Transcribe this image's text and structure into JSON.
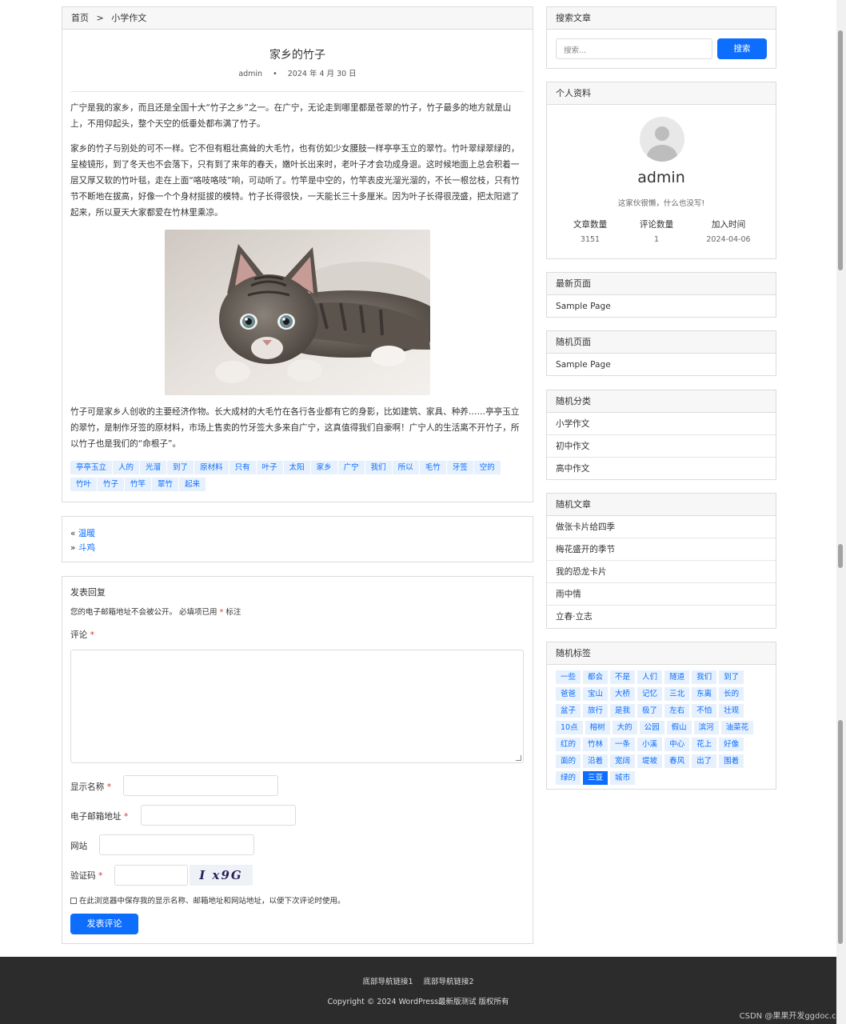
{
  "breadcrumb": {
    "home": "首页",
    "sep": ">",
    "current": "小学作文"
  },
  "post": {
    "title": "家乡的竹子",
    "author": "admin",
    "dot": "•",
    "date": "2024 年 4 月 30 日",
    "p1": "广宁是我的家乡，而且还是全国十大“竹子之乡”之一。在广宁，无论走到哪里都是苍翠的竹子，竹子最多的地方就是山上，不用仰起头，整个天空的低垂处都布满了竹子。",
    "p2": "家乡的竹子与别处的可不一样。它不但有粗壮高耸的大毛竹，也有仿如少女腰肢一样亭亭玉立的翠竹。竹叶翠绿翠绿的，呈棱镜形，到了冬天也不会落下，只有到了来年的春天，嫩叶长出来时，老叶子才会功成身退。这时候地面上总会积着一层又厚又软的竹叶毯，走在上面“咯吱咯吱”响，可动听了。竹竿是中空的，竹竿表皮光溜光溜的，不长一根岔枝，只有竹节不断地在拔高，好像一个个身材挺拔的模特。竹子长得很快，一天能长三十多厘米。因为叶子长得很茂盛，把太阳遮了起来，所以夏天大家都爱在竹林里乘凉。",
    "p3": "竹子可是家乡人创收的主要经济作物。长大成材的大毛竹在各行各业都有它的身影，比如建筑、家具、种养……亭亭玉立的翠竹，是制作牙签的原材料，市场上售卖的竹牙签大多来自广宁，这真值得我们自豪啊！广宁人的生活离不开竹子，所以竹子也是我们的“命根子”。",
    "tags": [
      "亭亭玉立",
      "人的",
      "光溜",
      "到了",
      "原材料",
      "只有",
      "叶子",
      "太阳",
      "家乡",
      "广宁",
      "我们",
      "所以",
      "毛竹",
      "牙签",
      "空的",
      "竹叶",
      "竹子",
      "竹竿",
      "翠竹",
      "起来"
    ]
  },
  "nav": {
    "prev_arrow": "«",
    "prev": "温暖",
    "next_arrow": "»",
    "next": "斗鸡"
  },
  "reply": {
    "heading": "发表回复",
    "note": "您的电子邮箱地址不会被公开。 必填项已用",
    "note_star": "*",
    "note_tail": "标注",
    "comment_label": "评论",
    "name_label": "显示名称",
    "email_label": "电子邮箱地址",
    "site_label": "网站",
    "captcha_label": "验证码",
    "required": "*",
    "captcha_text": "I x9G",
    "remember": "在此浏览器中保存我的显示名称、邮箱地址和网站地址，以便下次评论时使用。",
    "submit": "发表评论"
  },
  "sidebar": {
    "search": {
      "title": "搜索文章",
      "placeholder": "搜索...",
      "button": "搜索"
    },
    "profile": {
      "title": "个人资料",
      "name": "admin",
      "bio": "这家伙很懒，什么也没写!",
      "stats": [
        {
          "label": "文章数量",
          "value": "3151"
        },
        {
          "label": "评论数量",
          "value": "1"
        },
        {
          "label": "加入时间",
          "value": "2024-04-06"
        }
      ]
    },
    "latest": {
      "title": "最新页面",
      "items": [
        "Sample Page"
      ]
    },
    "random_page": {
      "title": "随机页面",
      "items": [
        "Sample Page"
      ]
    },
    "random_cat": {
      "title": "随机分类",
      "items": [
        "小学作文",
        "初中作文",
        "高中作文"
      ]
    },
    "random_post": {
      "title": "随机文章",
      "items": [
        "做张卡片给四季",
        "梅花盛开的季节",
        "我的恐龙卡片",
        "雨中情",
        "立春·立志"
      ]
    },
    "random_tag": {
      "title": "随机标签",
      "items": [
        "一些",
        "都会",
        "不是",
        "人们",
        "隧道",
        "我们",
        "到了",
        "爸爸",
        "宝山",
        "大桥",
        "记忆",
        "三北",
        "东离",
        "长的",
        "盆子",
        "旅行",
        "是我",
        "极了",
        "左右",
        "不怕",
        "壮观",
        "10点",
        "榕树",
        "大的",
        "公园",
        "假山",
        "滨河",
        "油菜花",
        "红的",
        "竹林",
        "一条",
        "小溪",
        "中心",
        "花上",
        "好像",
        "面的",
        "沿着",
        "宽阔",
        "堤坡",
        "春风",
        "出了",
        "围着",
        "绿的",
        "三亚",
        "城市"
      ],
      "active": "三亚"
    }
  },
  "footer": {
    "link1": "底部导航链接1",
    "link2": "底部导航链接2",
    "copyright": "Copyright © 2024 WordPress最新版测试 版权所有"
  },
  "watermark": "CSDN @果果开发ggdoc.cn"
}
